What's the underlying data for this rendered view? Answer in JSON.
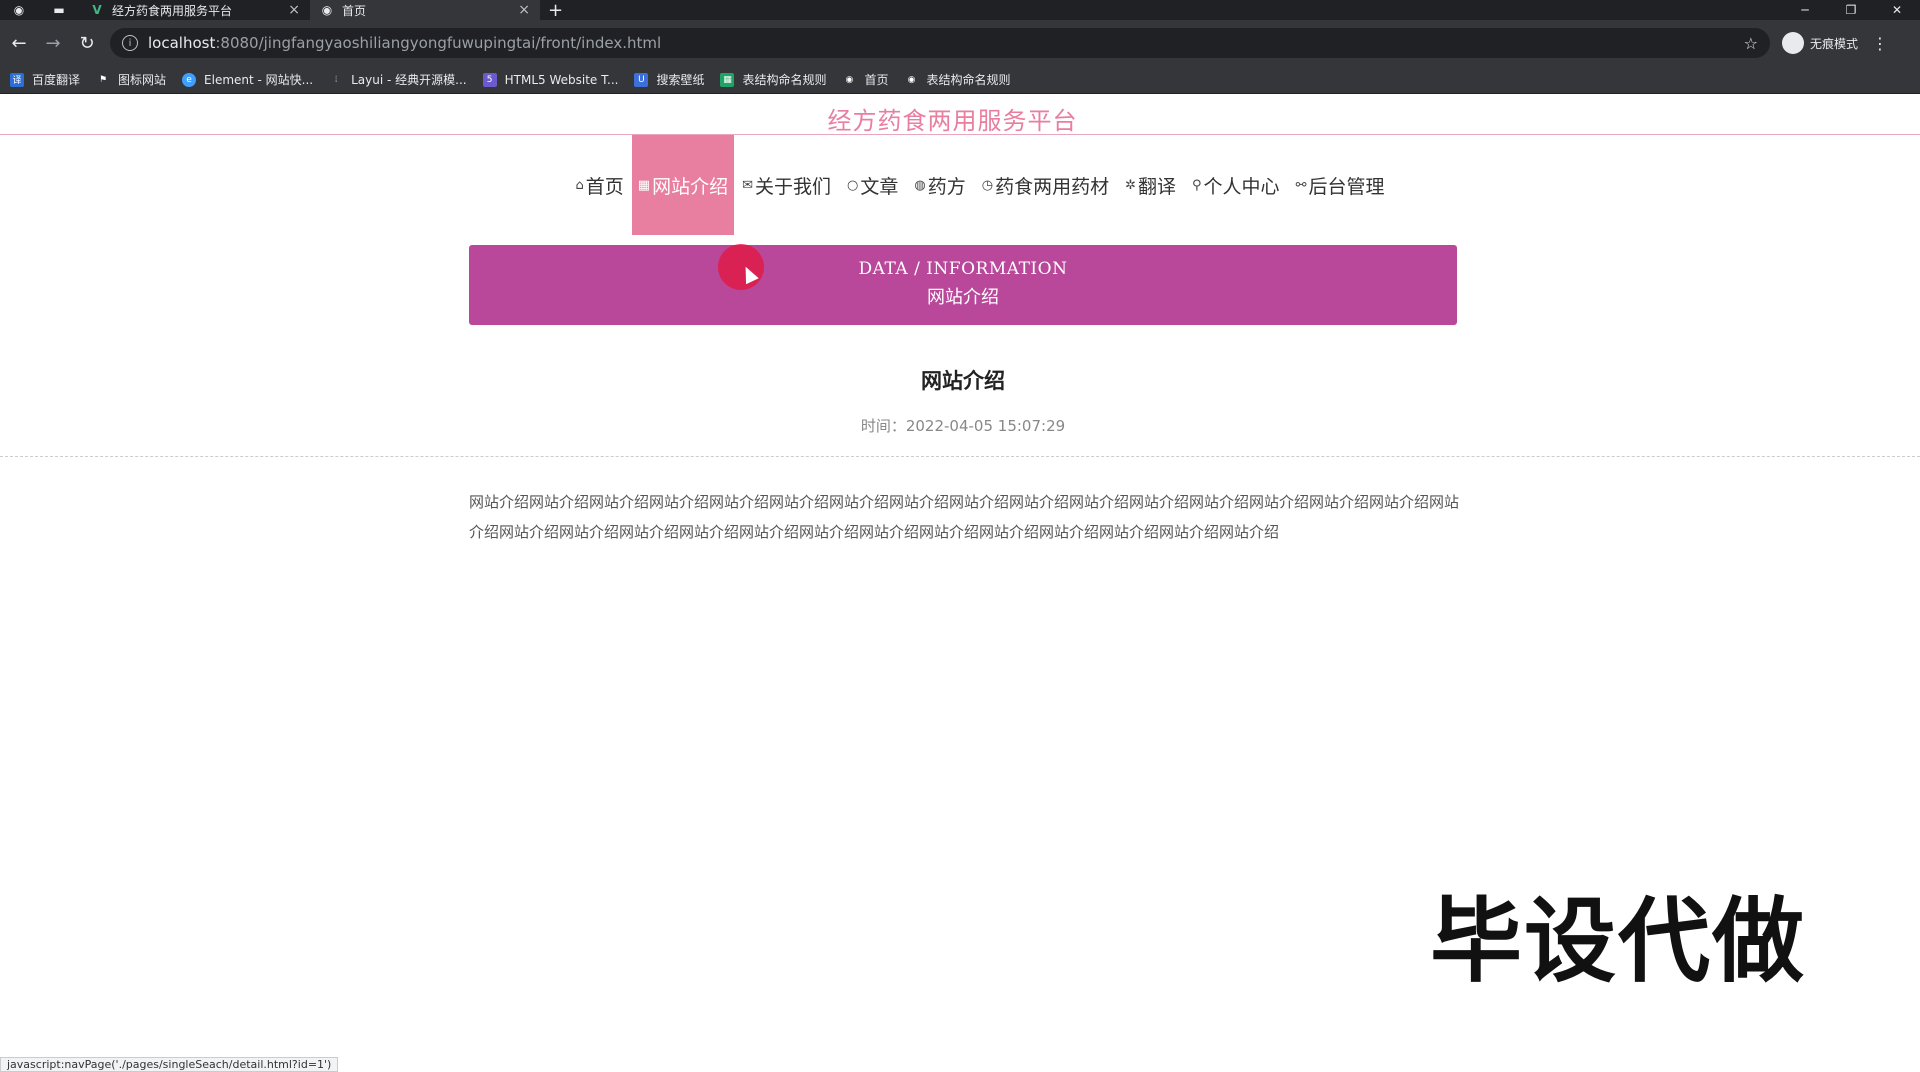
{
  "browser": {
    "tabs": [
      {
        "title": "经方药食两用服务平台",
        "close": "×",
        "active": false
      },
      {
        "title": "首页",
        "close": "×",
        "active": true
      }
    ],
    "new_tab": "+",
    "url_host": "localhost",
    "url_path": ":8080/jingfangyaoshiliangyongfuwupingtai/front/index.html",
    "profile": "无痕模式",
    "bookmarks": [
      "百度翻译",
      "图标网站",
      "Element - 网站快...",
      "Layui - 经典开源模...",
      "HTML5 Website T...",
      "搜索壁纸",
      "表结构命名规则",
      "首页",
      "表结构命名规则"
    ]
  },
  "site": {
    "title": "经方药食两用服务平台"
  },
  "nav": [
    {
      "icon": "⌂",
      "label": "首页"
    },
    {
      "icon": "▦",
      "label": "网站介绍"
    },
    {
      "icon": "✉",
      "label": "关于我们"
    },
    {
      "icon": "○",
      "label": "文章"
    },
    {
      "icon": "◍",
      "label": "药方"
    },
    {
      "icon": "◷",
      "label": "药食两用药材"
    },
    {
      "icon": "✲",
      "label": "翻译"
    },
    {
      "icon": "⚲",
      "label": "个人中心"
    },
    {
      "icon": "⚯",
      "label": "后台管理"
    }
  ],
  "banner": {
    "en": "DATA / INFORMATION",
    "zh": "网站介绍"
  },
  "article": {
    "title": "网站介绍",
    "time": "时间：2022-04-05 15:07:29",
    "body": "网站介绍网站介绍网站介绍网站介绍网站介绍网站介绍网站介绍网站介绍网站介绍网站介绍网站介绍网站介绍网站介绍网站介绍网站介绍网站介绍网站介绍网站介绍网站介绍网站介绍网站介绍网站介绍网站介绍网站介绍网站介绍网站介绍网站介绍网站介绍网站介绍网站介绍"
  },
  "watermark": "毕设代做",
  "status_url": "javascript:navPage('./pages/singleSeach/detail.html?id=1')",
  "colors": {
    "accent_pink": "#e87ea0",
    "banner": "#b9479a"
  }
}
